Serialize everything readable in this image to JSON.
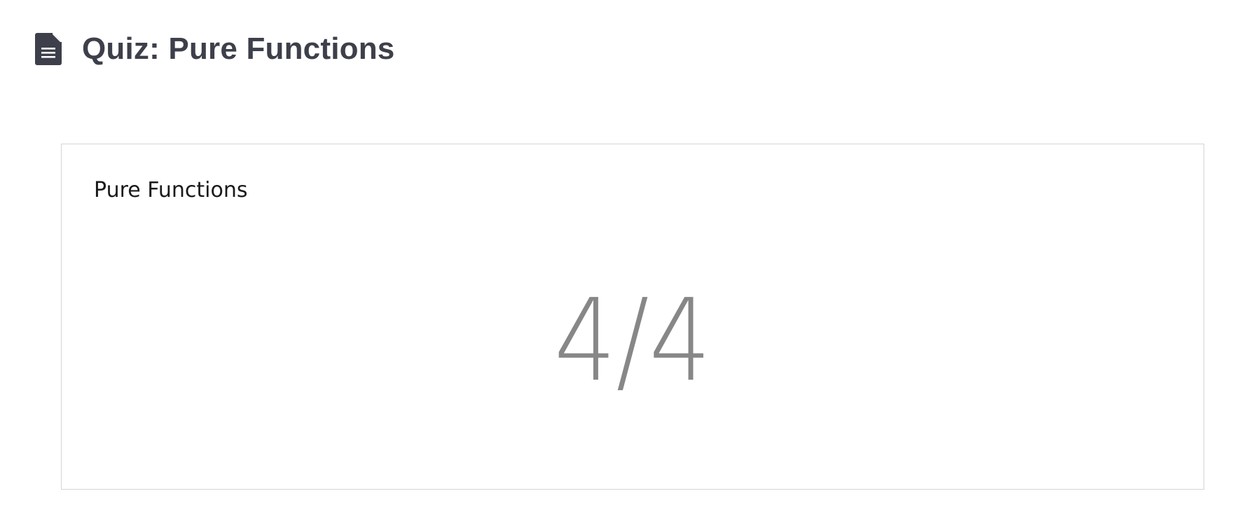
{
  "header": {
    "icon": "document-icon",
    "title": "Quiz: Pure Functions"
  },
  "quiz": {
    "title": "Pure Functions",
    "score": "4/4"
  },
  "colors": {
    "title_text": "#3d3f4a",
    "score_text": "#878787",
    "card_border": "#d4d4d4"
  }
}
